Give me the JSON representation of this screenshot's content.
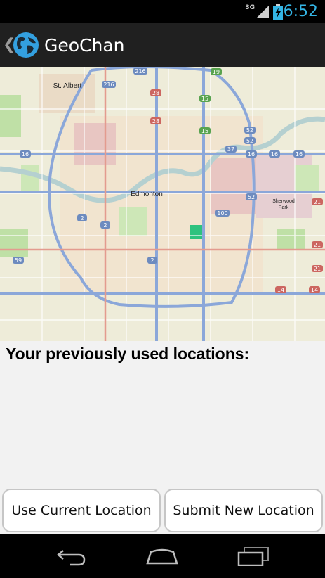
{
  "status_bar": {
    "network": "3G",
    "clock": "6:52",
    "icons": [
      "signal-icon",
      "battery-charging-icon"
    ]
  },
  "action_bar": {
    "title": "GeoChan",
    "icons": [
      "back-chevron-icon",
      "globe-icon"
    ]
  },
  "map": {
    "labels": {
      "st_albert": "St. Albert",
      "edmonton": "Edmonton",
      "sherwood_park_1": "Sherwood",
      "sherwood_park_2": "Park"
    },
    "route_shields": [
      "216",
      "216",
      "28",
      "28",
      "15",
      "15",
      "16",
      "16",
      "16",
      "16",
      "2",
      "2",
      "2",
      "14",
      "14",
      "21",
      "21",
      "21",
      "100",
      "52",
      "52",
      "52",
      "37",
      "19",
      "59"
    ]
  },
  "content": {
    "heading": "Your previously used locations:"
  },
  "buttons": {
    "use_current": "Use Current Location",
    "submit_new": "Submit New Location"
  },
  "nav_bar": {
    "icons": [
      "back-icon",
      "home-icon",
      "recent-apps-icon"
    ]
  },
  "colors": {
    "accent": "#33b5e5",
    "map_water": "#b5d0d0",
    "map_park": "#b5dfa0",
    "map_major_road": "#8ba7d9",
    "map_urban": "#f0d9b5"
  }
}
